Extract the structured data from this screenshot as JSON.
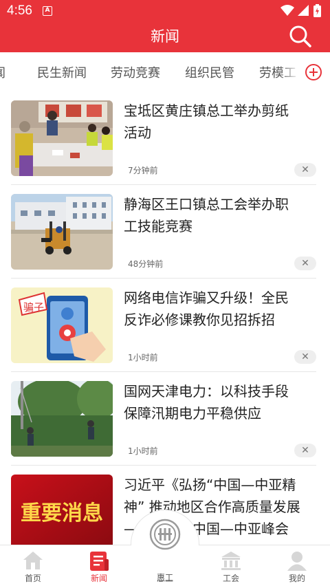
{
  "status_bar": {
    "time": "4:56",
    "app_icon_letter": "A",
    "icons": [
      "wifi-icon",
      "signal-icon",
      "battery-icon"
    ]
  },
  "header": {
    "title": "新闻",
    "search_icon": "search-icon"
  },
  "tabs": {
    "items": [
      "要闻",
      "民生新闻",
      "劳动竞赛",
      "组织民管",
      "劳模工"
    ],
    "partial_first": "闻",
    "add_icon": "add-circle-icon"
  },
  "news": [
    {
      "title": "宝坻区黄庄镇总工举办剪纸活动",
      "title_lines": [
        "宝坻区黄庄镇总工举办剪纸",
        "活动"
      ],
      "time": "7分钟前",
      "close": "✕"
    },
    {
      "title": "静海区王口镇总工会举办职工技能竞赛",
      "title_lines": [
        "静海区王口镇总工会举办职",
        "工技能竞赛"
      ],
      "time": "48分钟前",
      "close": "✕"
    },
    {
      "title": "网络电信诈骗又升级！全民反诈必修课教你见招拆招",
      "title_lines": [
        "网络电信诈骗又升级！全民",
        "反诈必修课教你见招拆招"
      ],
      "thumb_text": "骗子",
      "time": "1小时前",
      "close": "✕"
    },
    {
      "title": "国网天津电力：以科技手段保障汛期电力平稳供应",
      "title_lines": [
        "国网天津电力：以科技手段",
        "保障汛期电力平稳供应"
      ],
      "time": "1小时前",
      "close": "✕"
    },
    {
      "title": "习近平《弘扬“中国—中亚精神” 推动地区合作高质量发展 —— 在首届中国—中亚峰会",
      "title_lines": [
        "习近平《弘扬“中国—中亚精",
        "神” 推动地区合作高质量发展",
        "——在首届中国—中亚峰会"
      ],
      "thumb_text": "重要消息"
    }
  ],
  "bottom_nav": [
    {
      "label": "首页",
      "icon": "home-icon"
    },
    {
      "label": "新闻",
      "icon": "news-icon"
    },
    {
      "label": "惠工",
      "icon": "union-logo-icon"
    },
    {
      "label": "工会",
      "icon": "institution-icon"
    },
    {
      "label": "我的",
      "icon": "user-icon"
    }
  ],
  "colors": {
    "brand_red": "#e8333a",
    "text": "#222222",
    "muted": "#666666"
  }
}
